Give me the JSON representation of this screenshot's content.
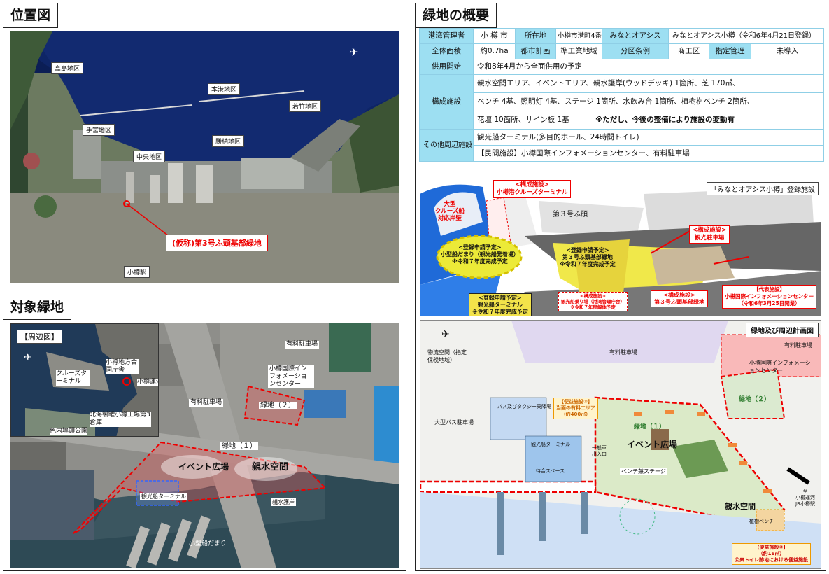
{
  "location_map": {
    "title": "位置図",
    "areas": [
      "高島地区",
      "本港地区",
      "若竹地区",
      "手宮地区",
      "勝納地区",
      "中央地区"
    ],
    "callout": "(仮称)第3号ふ頭基部緑地",
    "station": "小樽駅"
  },
  "target_green": {
    "title": "対象緑地",
    "inset_title": "【周辺図】",
    "inset_labels": [
      "小樽地方合同庁舎",
      "小樽運河",
      "クルーズターミナル",
      "北海製罐小樽工場第3倉庫",
      "色内埠頭公園"
    ],
    "labels": [
      "有料駐車場",
      "小樽国際インフォメーションセンター",
      "緑地（２）",
      "有料駐車場",
      "緑地（１）",
      "イベント広場",
      "親水空間",
      "観光船ターミナル",
      "親水護岸",
      "小型船だまり"
    ]
  },
  "overview": {
    "title": "緑地の概要",
    "row1": {
      "h1": "港湾管理者",
      "v1": "小 樽 市",
      "h2": "所在地",
      "v2": "小樽市港町4番",
      "h3": "みなとオアシス",
      "v3": "みなとオアシス小樽（令和6年4月21日登録）"
    },
    "row2": {
      "h1": "全体面積",
      "v1": "約0.7ha",
      "h2": "都市計画",
      "v2": "準工業地域",
      "h3": "分区条例",
      "v3": "商工区",
      "h4": "指定管理",
      "v4": "未導入"
    },
    "row3": {
      "h": "供用開始",
      "v": "令和8年4月から全面供用の予定"
    },
    "facilities": {
      "h": "構成施設",
      "lines": [
        "親水空間エリア、イベントエリア、親水護岸(ウッドデッキ) 1箇所、芝 170㎡、",
        "ベンチ 4基、照明灯 4基、ステージ 1箇所、水飲み台 1箇所、植樹桝ベンチ 2箇所、",
        "花壇 10箇所、サイン板 1基"
      ],
      "note": "※ただし、今後の整備により施設の変動有"
    },
    "nearby": {
      "h": "その他周辺施設",
      "lines": [
        "観光船ターミナル(多目的ホール、24時間トイレ)",
        "【民間施設】小樽国際インフォメーションセンター、有料駐車場"
      ]
    }
  },
  "illustration": {
    "title": "「みなとオアシス小樽」登録施設",
    "c1": [
      "<構成施設>",
      "小樽港クルーズターミナル"
    ],
    "c2": [
      "大型",
      "クルーズ船",
      "対応岸壁"
    ],
    "c3": "第３号ふ頭",
    "c4": [
      "<構成施設>",
      "観光駐車場"
    ],
    "c5": [
      "<登録申請予定>",
      "小型船だまり（観光船発着場）",
      "※令和７年度完成予定"
    ],
    "c6": [
      "<登録申請予定>",
      "第３号ふ頭基部緑地",
      "※令和７年度完成予定"
    ],
    "c7": [
      "<登録申請予定>",
      "観光船ターミナル",
      "※令和７年度完成予定"
    ],
    "c8": [
      "<構成施設>",
      "観光船乗り場（港湾管理庁舎）",
      "※令和７年度解体予定"
    ],
    "c9": [
      "<構成施設>",
      "第３号ふ頭基部緑地"
    ],
    "c10": [
      "【代表施設】",
      "小樽国際インフォメーションセンター",
      "（令和6年3月25日開業）"
    ]
  },
  "plan": {
    "title": "緑地及び周辺計画図",
    "labels": {
      "parking1": "有料駐車場",
      "parking2": "有料駐車場",
      "info": "小樽国際インフォメーションセンター",
      "green2": "緑地（２）",
      "green1": "緑地（１）",
      "event": "イベント広場",
      "waterside": "親水空間",
      "stage": "ベンチ兼ステージ",
      "bus": "大型バス駐車場",
      "taxi": "バス及びタクシー乗降場",
      "terminal": "観光船ターミナル",
      "walk": "待合スペース",
      "space": "物流空間（指定保税地域）",
      "bench": "植樹ベンチ",
      "toilet": [
        "【便益施設②】",
        "（約16㎡）",
        "公衆トイレ跡地における便益施設"
      ],
      "conv": [
        "【便益施設③】",
        "当面の有料エリア",
        "（約400㎡）"
      ],
      "station": [
        "至",
        "小樽運河",
        "JR小樽駅"
      ],
      "entrance": [
        "一般車",
        "出入口"
      ]
    }
  }
}
